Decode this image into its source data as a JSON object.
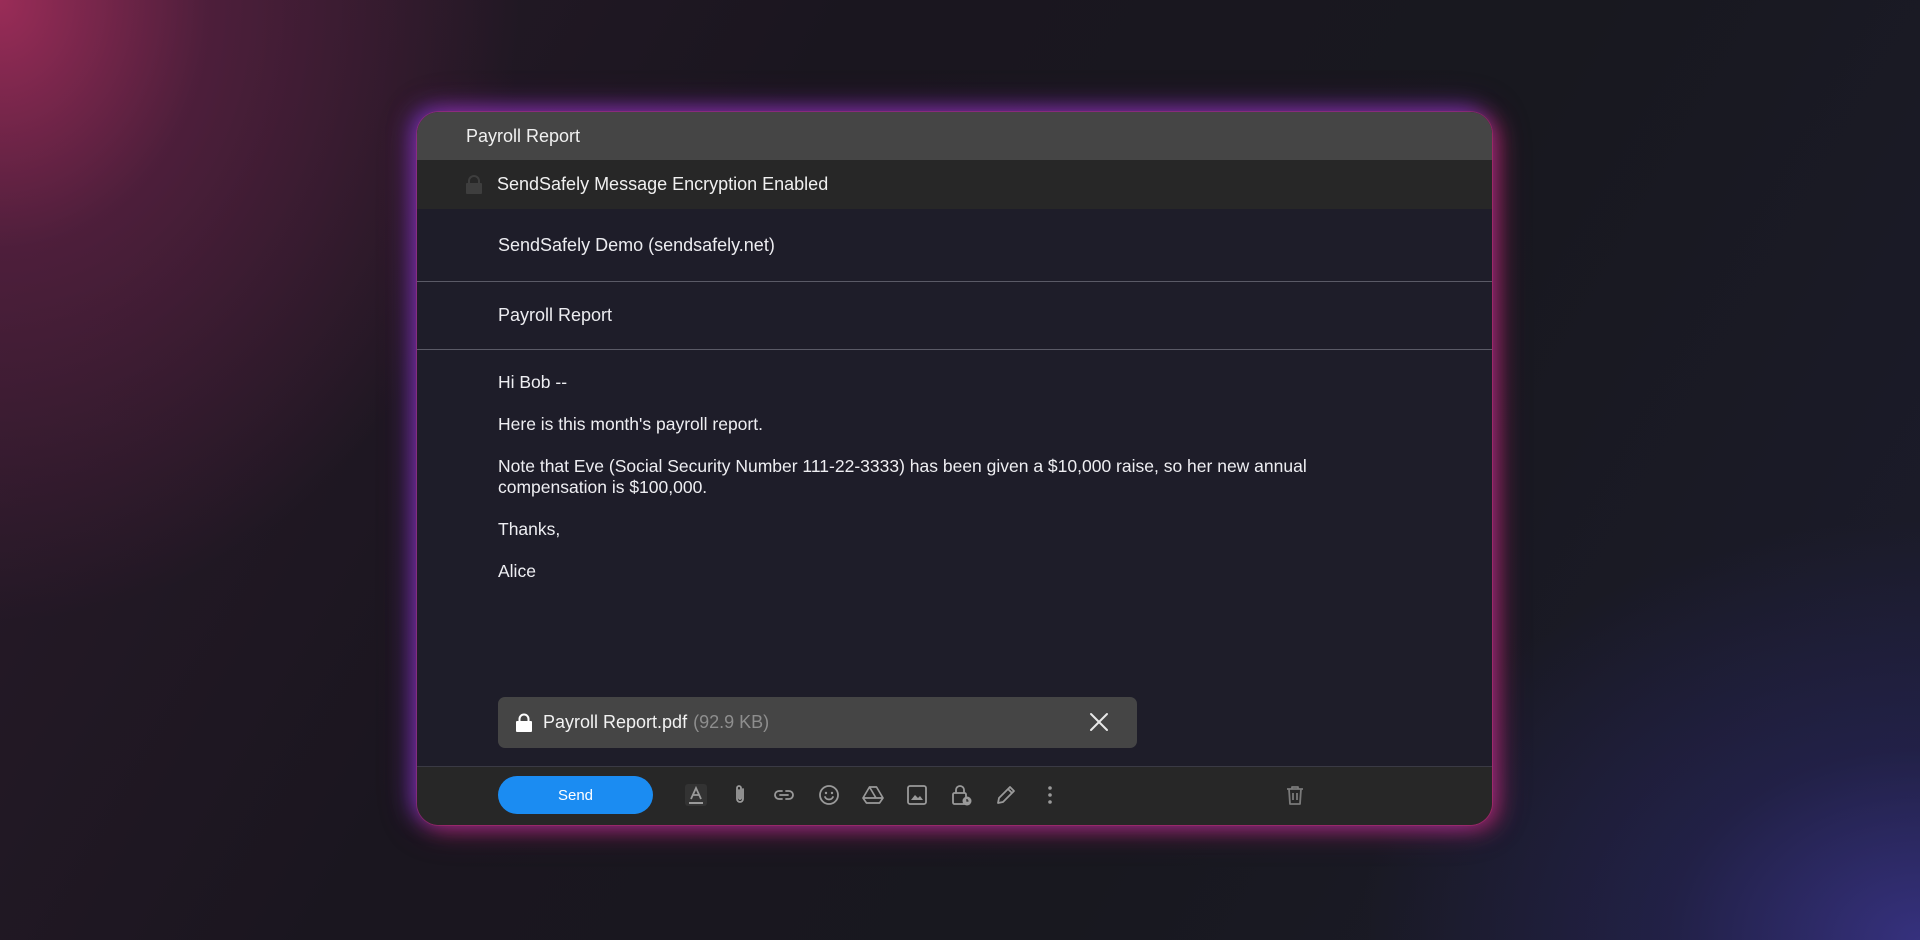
{
  "window": {
    "title": "Payroll Report"
  },
  "encryption": {
    "label": "SendSafely Message Encryption Enabled",
    "icon": "lock-icon"
  },
  "from": {
    "value": "SendSafely Demo (sendsafely.net)"
  },
  "subject": {
    "value": "Payroll Report"
  },
  "message": {
    "paragraphs": [
      "Hi Bob --",
      "Here is this month's payroll report.",
      "Note that Eve (Social Security Number 111-22-3333) has been given a $10,000 raise, so her new annual compensation is $100,000.",
      "Thanks,",
      "Alice"
    ]
  },
  "attachment": {
    "icon": "lock-icon",
    "filename": "Payroll Report.pdf",
    "size": "(92.9 KB)"
  },
  "toolbar": {
    "send_label": "Send",
    "icons": [
      "text-format-icon",
      "attach-icon",
      "link-icon",
      "emoji-icon",
      "drive-icon",
      "image-icon",
      "lock-clock-icon",
      "pen-icon",
      "more-options-icon",
      "trash-icon"
    ]
  },
  "colors": {
    "accent": "#1b8cf2",
    "titlebar": "#454545",
    "compose_bg": "#1e1d29"
  }
}
